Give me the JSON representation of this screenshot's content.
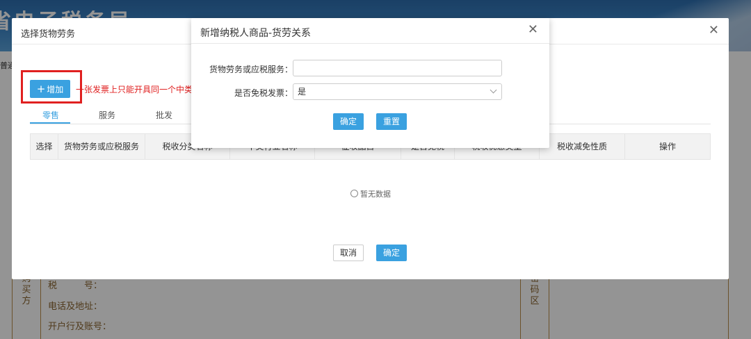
{
  "background": {
    "banner_title": "省电子税务局",
    "side_label": "普通",
    "buyer_label": "购买方",
    "buyer_rows": [
      "税　　　号：",
      "电话及地址：",
      "开户行及账号："
    ],
    "password_label": "密码区"
  },
  "dialog1": {
    "title": "选择货物劳务",
    "close_icon": "close-icon",
    "add_button": "增加",
    "warning": "一张发票上只能开具同一个中类",
    "tabs": [
      "零售",
      "服务",
      "批发"
    ],
    "columns": [
      "选择",
      "货物劳务或应税服务",
      "税收分类名称",
      "中类行业名称",
      "征收品目",
      "是否免税",
      "税收优惠类型",
      "税收减免性质",
      "操作"
    ],
    "empty_text": "暂无数据",
    "cancel_button": "取消",
    "confirm_button": "确定"
  },
  "dialog2": {
    "title": "新增纳税人商品-货劳关系",
    "close_icon": "close-icon",
    "field_goods_label": "货物劳务或应税服务：",
    "field_goods_value": "",
    "field_exempt_label": "是否免税发票：",
    "field_exempt_value": "是",
    "confirm_button": "确定",
    "reset_button": "重置"
  },
  "colors": {
    "accent": "#3aa1e0",
    "warning": "#e02020",
    "invoice_border": "#b98d4b"
  }
}
